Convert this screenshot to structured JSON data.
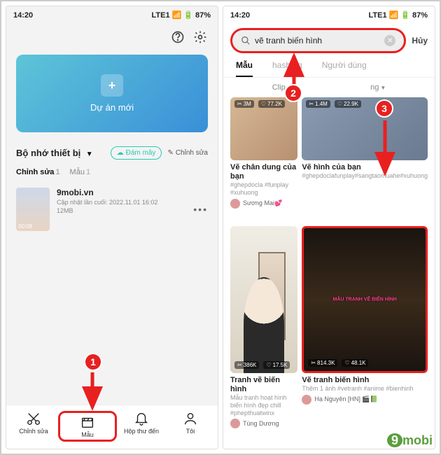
{
  "status": {
    "time": "14:20",
    "battery": "87%",
    "net": "LTE1"
  },
  "left": {
    "new_project": "Dự án mới",
    "storage_title": "Bộ nhớ thiết bị",
    "cloud_btn": "Đám mây",
    "edit_btn": "Chỉnh sửa",
    "tab_edit": "Chỉnh sửa",
    "tab_edit_count": "1",
    "tab_template": "Mẫu",
    "tab_template_count": "1",
    "project": {
      "name": "9mobi.vn",
      "updated": "Cập nhật lần cuối: 2022.11.01 16:02",
      "size": "12MB",
      "duration": "00:08"
    },
    "nav": {
      "edit": "Chỉnh sửa",
      "template": "Mẫu",
      "inbox": "Hộp thư đến",
      "me": "Tôi"
    }
  },
  "right": {
    "search_query": "vẽ tranh biến hình",
    "cancel": "Hủy",
    "tabs": {
      "template": "Mẫu",
      "hashtag": "hashtag",
      "user": "Người dùng"
    },
    "cards": [
      {
        "views": "3M",
        "likes": "77.2K",
        "title": "Vẽ chân dung của bạn",
        "sub": "#ghepdocla #funplay #xuhuong",
        "user": "Sương Mai💕"
      },
      {
        "views": "1.4M",
        "likes": "22.9K",
        "title": "Vẽ hình của bạn",
        "sub": "#ghepdoclafunplay#sangtaomuahe#xuhuong",
        "user": ""
      },
      {
        "views": "386K",
        "likes": "17.5K",
        "title": "Tranh vẽ biến hình",
        "sub": "Mẫu tranh hoạt hình biến hình đẹp chill #phepthuatwinx",
        "user": "Tùng Dương"
      },
      {
        "views": "814.3K",
        "likes": "48.1K",
        "title": "Vẽ tranh biến hình",
        "sub": "Thêm 1 ảnh #vetranh #anime #bienhinh",
        "user": "Hạ Nguyên [HN] 🎬📗",
        "overlay": "MẪU TRANH VẼ BIẾN HÌNH"
      }
    ]
  },
  "annotations": {
    "n1": "1",
    "n2": "2",
    "n3": "3"
  },
  "logo": {
    "nine": "9",
    "text": "mobi"
  }
}
